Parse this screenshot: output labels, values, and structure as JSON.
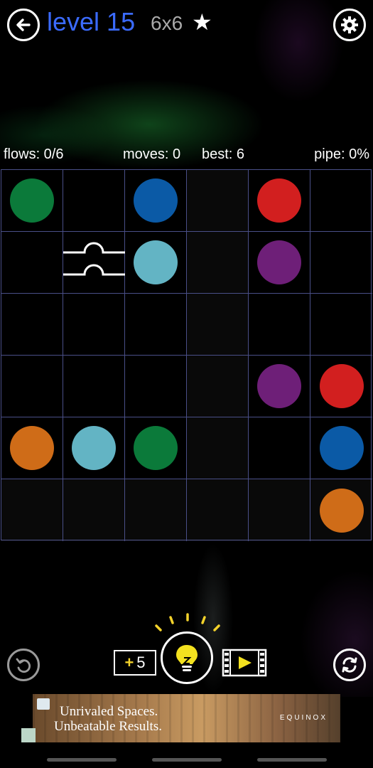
{
  "header": {
    "level_label": "level 15",
    "size_label": "6x6",
    "star": "★",
    "back_icon": "back-arrow-icon",
    "settings_icon": "gear-icon"
  },
  "stats": {
    "flows": "flows: 0/6",
    "moves": "moves: 0",
    "best": "best: 6",
    "pipe": "pipe: 0%"
  },
  "colors": {
    "green": "#0b7a3a",
    "blue": "#0b5aa6",
    "red": "#d21f1f",
    "cyan": "#63b4c4",
    "purple": "#6e1f78",
    "orange": "#cf6c18",
    "grid": "#4a4f88"
  },
  "board": {
    "cols": 6,
    "rows": 6,
    "cells": [
      [
        "green",
        "",
        "blue",
        "",
        "red",
        ""
      ],
      [
        "",
        "bridge",
        "cyan",
        "",
        "purple",
        ""
      ],
      [
        "",
        "",
        "",
        "",
        "",
        ""
      ],
      [
        "",
        "",
        "",
        "",
        "purple",
        "red"
      ],
      [
        "orange",
        "cyan",
        "green",
        "",
        "",
        "blue"
      ],
      [
        "",
        "",
        "",
        "",
        "",
        "orange"
      ]
    ]
  },
  "controls": {
    "hint_plus": "+",
    "hint_count": "5",
    "undo_icon": "undo-icon",
    "hint_icon": "lightbulb-icon",
    "video_icon": "video-play-icon",
    "restart_icon": "restart-icon"
  },
  "ad": {
    "line1": "Unrivaled Spaces.",
    "line2": "Unbeatable Results.",
    "brand": "EQUINOX"
  }
}
